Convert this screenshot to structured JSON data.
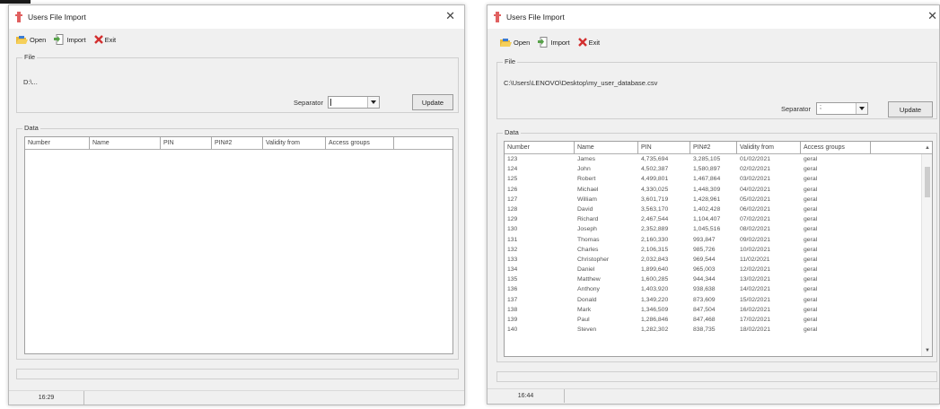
{
  "left_window": {
    "title": "Users File Import",
    "toolbar": {
      "open": "Open",
      "import": "Import",
      "exit": "Exit"
    },
    "file_group": {
      "label": "File",
      "path": "D:\\...",
      "separator_label": "Separator",
      "separator_value": "",
      "update": "Update"
    },
    "data_group": {
      "label": "Data",
      "columns": [
        "Number",
        "Name",
        "PIN",
        "PIN#2",
        "Validity from",
        "Access groups"
      ]
    },
    "status": {
      "time": "16:29"
    }
  },
  "right_window": {
    "title": "Users File Import",
    "toolbar": {
      "open": "Open",
      "import": "Import",
      "exit": "Exit"
    },
    "file_group": {
      "label": "File",
      "path": "C:\\Users\\LENOVO\\Desktop\\my_user_database.csv",
      "separator_label": "Separator",
      "separator_value": ";",
      "update": "Update"
    },
    "data_group": {
      "label": "Data",
      "columns": [
        "Number",
        "Name",
        "PIN",
        "PIN#2",
        "Validity from",
        "Access groups"
      ],
      "rows": [
        [
          "123",
          "James",
          "4,735,694",
          "3,285,105",
          "01/02/2021",
          "geral"
        ],
        [
          "124",
          "John",
          "4,502,387",
          "1,580,897",
          "02/02/2021",
          "geral"
        ],
        [
          "125",
          "Robert",
          "4,499,801",
          "1,467,864",
          "03/02/2021",
          "geral"
        ],
        [
          "126",
          "Michael",
          "4,330,025",
          "1,448,309",
          "04/02/2021",
          "geral"
        ],
        [
          "127",
          "William",
          "3,601,719",
          "1,428,961",
          "05/02/2021",
          "geral"
        ],
        [
          "128",
          "David",
          "3,563,170",
          "1,402,428",
          "06/02/2021",
          "geral"
        ],
        [
          "129",
          "Richard",
          "2,467,544",
          "1,104,407",
          "07/02/2021",
          "geral"
        ],
        [
          "130",
          "Joseph",
          "2,352,889",
          "1,045,516",
          "08/02/2021",
          "geral"
        ],
        [
          "131",
          "Thomas",
          "2,160,330",
          "993,847",
          "09/02/2021",
          "geral"
        ],
        [
          "132",
          "Charles",
          "2,106,315",
          "985,726",
          "10/02/2021",
          "geral"
        ],
        [
          "133",
          "Christopher",
          "2,032,843",
          "969,544",
          "11/02/2021",
          "geral"
        ],
        [
          "134",
          "Daniel",
          "1,899,640",
          "965,003",
          "12/02/2021",
          "geral"
        ],
        [
          "135",
          "Matthew",
          "1,600,285",
          "944,344",
          "13/02/2021",
          "geral"
        ],
        [
          "136",
          "Anthony",
          "1,403,920",
          "938,638",
          "14/02/2021",
          "geral"
        ],
        [
          "137",
          "Donald",
          "1,349,220",
          "873,609",
          "15/02/2021",
          "geral"
        ],
        [
          "138",
          "Mark",
          "1,346,509",
          "847,504",
          "16/02/2021",
          "geral"
        ],
        [
          "139",
          "Paul",
          "1,286,846",
          "847,468",
          "17/02/2021",
          "geral"
        ],
        [
          "140",
          "Steven",
          "1,282,302",
          "838,735",
          "18/02/2021",
          "geral"
        ]
      ]
    },
    "status": {
      "time": "16:44"
    }
  },
  "icons": {
    "app": "app-icon",
    "open": "folder-open-icon",
    "import": "import-document-icon",
    "exit": "red-x-icon",
    "close": "close-icon",
    "sort": "sort-arrow-icon"
  },
  "colors": {
    "window_bg": "#f0f0f0",
    "exit_red": "#d32f2f",
    "folder_yellow": "#e9b93a",
    "import_green": "#58a24a",
    "app_icon_red": "#e06060"
  }
}
